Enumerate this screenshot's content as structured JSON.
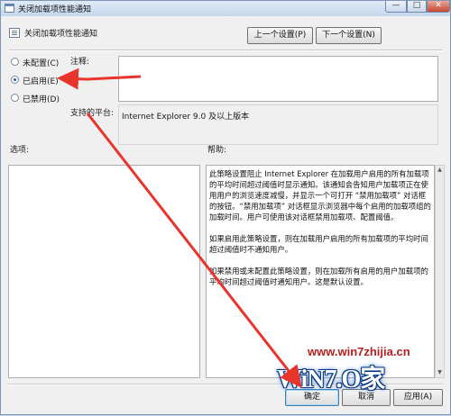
{
  "window": {
    "title": "关闭加载项性能通知",
    "minimize_glyph": "—",
    "maximize_glyph": "□",
    "close_glyph": "✕"
  },
  "header": {
    "setting_title": "关闭加载项性能通知",
    "prev_button": "上一个设置(P)",
    "next_button": "下一个设置(N)"
  },
  "state": {
    "options": [
      {
        "label": "未配置(C)",
        "selected": false
      },
      {
        "label": "已启用(E)",
        "selected": true
      },
      {
        "label": "已禁用(D)",
        "selected": false
      }
    ]
  },
  "comment": {
    "label": "注释:",
    "value": ""
  },
  "platform": {
    "label": "支持的平台:",
    "value": "Internet Explorer 9.0 及以上版本"
  },
  "options_panel": {
    "label": "选项:"
  },
  "help_panel": {
    "label": "帮助:",
    "paragraphs": [
      "此策略设置阻止 Internet Explorer 在加载用户启用的所有加载项的平均时间超过阈值时显示通知。该通知会告知用户加载项正在使用用户的浏览速度减慢，并显示一个可打开 “禁用加载项” 对话框的按钮。“禁用加载项” 对话框显示浏览器中每个启用的加载项组的加载时间。用户可使用该对话框禁用加载项、配置阈值。",
      "如果启用此策略设置，则在加载用户启用的所有加载项的平均时间超过阈值时不通知用户。",
      "如果禁用或未配置此策略设置，则在加载所有启用的用户加载项的平均时间超过阈值时通知用户。这是默认设置。"
    ]
  },
  "footer": {
    "ok": "确定",
    "cancel": "取消",
    "apply": "应用(A)"
  },
  "watermark": {
    "url": "www.win7zhijia.cn",
    "logo": "WiN7.O家"
  },
  "colors": {
    "annotation_arrow": "#e8342a",
    "window_frame": "#d9e6f4",
    "dialog_bg": "#f0f0f0"
  }
}
